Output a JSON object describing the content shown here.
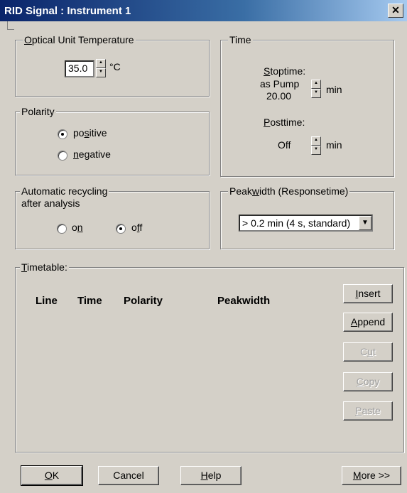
{
  "window": {
    "title": "RID Signal : Instrument 1",
    "close_glyph": "✕"
  },
  "temperature": {
    "legend_pre": "",
    "legend_u": "O",
    "legend_post": "ptical Unit Temperature",
    "value": "35.0",
    "unit": "°C"
  },
  "time": {
    "legend": "Time",
    "stoptime_u": "S",
    "stoptime_rest": "toptime:",
    "stoptime_line1": "as Pump",
    "stoptime_line2": "20.00",
    "stoptime_unit": "min",
    "posttime_u": "P",
    "posttime_rest": "osttime:",
    "posttime_value": "Off",
    "posttime_unit": "min"
  },
  "polarity": {
    "legend": "Polarity",
    "options": [
      {
        "pre": "po",
        "u": "s",
        "post": "itive",
        "checked": true
      },
      {
        "pre": "",
        "u": "n",
        "post": "egative",
        "checked": false
      }
    ]
  },
  "recycling": {
    "legend": "Automatic recycling",
    "subtitle": "after analysis",
    "on_pre": "o",
    "on_u": "n",
    "off_pre": "o",
    "off_u": "f",
    "off_post": "f",
    "selected": "off"
  },
  "peakwidth": {
    "legend_pre": "Peak",
    "legend_u": "w",
    "legend_post": "idth (Responsetime)",
    "value": "> 0.2 min  (4 s, standard)"
  },
  "timetable": {
    "legend_u": "T",
    "legend_rest": "imetable:",
    "columns": [
      "Line",
      "Time",
      "Polarity",
      "Peakwidth"
    ],
    "buttons": {
      "insert_u": "I",
      "insert_rest": "nsert",
      "append_u": "A",
      "append_rest": "ppend",
      "cut_pre": "C",
      "cut_u": "u",
      "cut_post": "t",
      "copy_u": "C",
      "copy_rest": "opy",
      "paste_u": "P",
      "paste_rest": "aste"
    }
  },
  "footer": {
    "ok_u": "O",
    "ok_rest": "K",
    "cancel": "Cancel",
    "help_u": "H",
    "help_rest": "elp",
    "more_u": "M",
    "more_rest": "ore >>"
  }
}
